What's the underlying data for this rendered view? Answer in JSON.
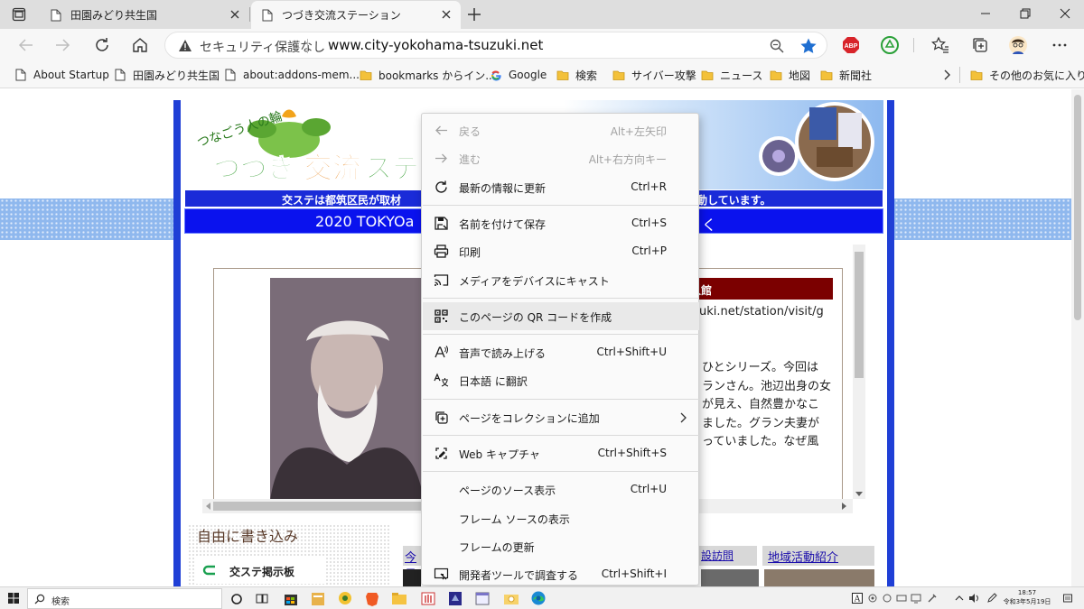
{
  "browser": {
    "tabs": [
      {
        "title": "田園みどり共生国",
        "active": false
      },
      {
        "title": "つづき交流ステーション",
        "active": true
      }
    ],
    "address": {
      "security_text": "セキュリティ保護なし",
      "url": "www.city-yokohama-tsuzuki.net"
    },
    "bookmarks": [
      {
        "label": "About Startup",
        "icon": "page-icon"
      },
      {
        "label": "田園みどり共生国",
        "icon": "page-icon"
      },
      {
        "label": "about:addons-mem...",
        "icon": "page-icon"
      },
      {
        "label": "bookmarks からイン...",
        "icon": "folder-icon"
      },
      {
        "label": "Google",
        "icon": "google-icon"
      },
      {
        "label": "検索",
        "icon": "folder-icon"
      },
      {
        "label": "サイバー攻撃",
        "icon": "folder-icon"
      },
      {
        "label": "ニュース",
        "icon": "folder-icon"
      },
      {
        "label": "地図",
        "icon": "folder-icon"
      },
      {
        "label": "新聞社",
        "icon": "folder-icon"
      }
    ],
    "other_favorites": "その他のお気に入り",
    "extensions": {
      "abp": "ABP"
    },
    "colors": {
      "accent": "#0078d4",
      "star": "#1f6fd1"
    }
  },
  "page": {
    "logo_tagline": "つなごう人の輪",
    "logo_title_parts": [
      "つづき",
      "交流",
      "ステー"
    ],
    "banner1_left": "交ステは都筑区民が取材",
    "banner1_right": "動しています。",
    "banner2_left": "2020 TOKYOa",
    "banner2_right": "く",
    "red_title": "人館",
    "link_fragment": "uki.net/station/visit/g",
    "body_lines": [
      "ひとシリーズ。今回は",
      "ランさん。池辺出身の女",
      "が見え、自然豊かなこ",
      "ました。グラン夫妻が",
      "っていました。なぜ風"
    ],
    "free_heading": "自由に書き込み",
    "board_label": "交ステ掲示板",
    "lower_links": [
      "今日",
      "設訪問",
      "地域活動紹介"
    ],
    "colors": {
      "frame": "#1f3fd6",
      "banner": "#0a12ee",
      "title_red": "#7b0000"
    }
  },
  "context_menu": {
    "groups": [
      [
        {
          "label": "戻る",
          "shortcut": "Alt+左矢印",
          "icon": "back-arrow-icon",
          "disabled": true
        },
        {
          "label": "進む",
          "shortcut": "Alt+右方向キー",
          "icon": "forward-arrow-icon",
          "disabled": true
        },
        {
          "label": "最新の情報に更新",
          "shortcut": "Ctrl+R",
          "icon": "refresh-icon",
          "disabled": false
        }
      ],
      [
        {
          "label": "名前を付けて保存",
          "shortcut": "Ctrl+S",
          "icon": "save-icon",
          "disabled": false
        },
        {
          "label": "印刷",
          "shortcut": "Ctrl+P",
          "icon": "print-icon",
          "disabled": false
        },
        {
          "label": "メディアをデバイスにキャスト",
          "shortcut": "",
          "icon": "cast-icon",
          "disabled": false
        }
      ],
      [
        {
          "label": "このページの QR コードを作成",
          "shortcut": "",
          "icon": "qr-code-icon",
          "disabled": false,
          "highlighted": true
        }
      ],
      [
        {
          "label": "音声で読み上げる",
          "shortcut": "Ctrl+Shift+U",
          "icon": "read-aloud-icon",
          "disabled": false
        },
        {
          "label": "日本語 に翻訳",
          "shortcut": "",
          "icon": "translate-icon",
          "disabled": false
        }
      ],
      [
        {
          "label": "ページをコレクションに追加",
          "shortcut": "",
          "icon": "collections-icon",
          "disabled": false,
          "submenu": true
        }
      ],
      [
        {
          "label": "Web キャプチャ",
          "shortcut": "Ctrl+Shift+S",
          "icon": "web-capture-icon",
          "disabled": false
        }
      ],
      [
        {
          "label": "ページのソース表示",
          "shortcut": "Ctrl+U",
          "icon": "",
          "disabled": false
        },
        {
          "label": "フレーム ソースの表示",
          "shortcut": "",
          "icon": "",
          "disabled": false
        },
        {
          "label": "フレームの更新",
          "shortcut": "",
          "icon": "",
          "disabled": false
        },
        {
          "label": "開発者ツールで調査する",
          "shortcut": "Ctrl+Shift+I",
          "icon": "devtools-icon",
          "disabled": false
        }
      ]
    ]
  },
  "taskbar": {
    "search_placeholder": "検索",
    "clock_time": "18:57",
    "clock_date": "令和3年5月19日",
    "ime_label": "A"
  }
}
